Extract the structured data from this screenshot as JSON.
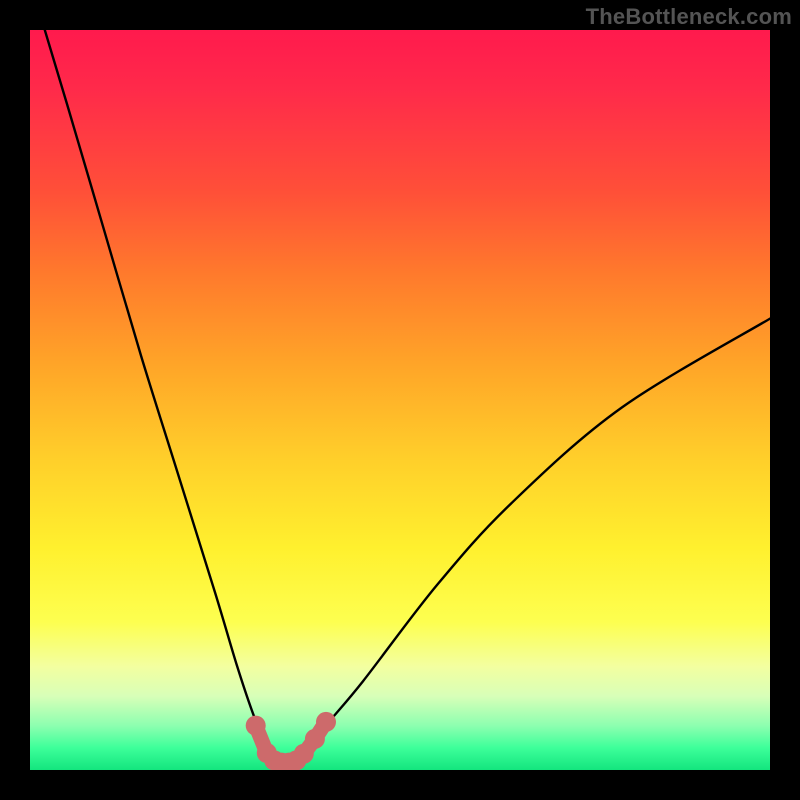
{
  "watermark": "TheBottleneck.com",
  "chart_data": {
    "type": "line",
    "title": "",
    "xlabel": "",
    "ylabel": "",
    "xlim": [
      0,
      100
    ],
    "ylim": [
      0,
      100
    ],
    "series": [
      {
        "name": "bottleneck-curve",
        "x": [
          2,
          5,
          10,
          15,
          20,
          25,
          28,
          30,
          32,
          33,
          34,
          35,
          36,
          38,
          40,
          45,
          55,
          65,
          80,
          100
        ],
        "y": [
          100,
          90,
          73,
          56,
          40,
          24,
          14,
          8,
          3,
          1.5,
          1,
          1,
          1.5,
          3,
          6,
          12,
          25,
          36,
          49,
          61
        ]
      }
    ],
    "markers": {
      "name": "highlight-points",
      "x": [
        30.5,
        32,
        33,
        34,
        35,
        36,
        37,
        38.5,
        40
      ],
      "y": [
        6,
        2.3,
        1.3,
        1.0,
        1.0,
        1.3,
        2.2,
        4.2,
        6.5
      ]
    },
    "gradient_stops": [
      {
        "pos": 0.0,
        "color": "#ff1a4d"
      },
      {
        "pos": 0.3,
        "color": "#ff7a2c"
      },
      {
        "pos": 0.6,
        "color": "#ffe02a"
      },
      {
        "pos": 0.85,
        "color": "#f3ffa0"
      },
      {
        "pos": 1.0,
        "color": "#13e57e"
      }
    ]
  }
}
